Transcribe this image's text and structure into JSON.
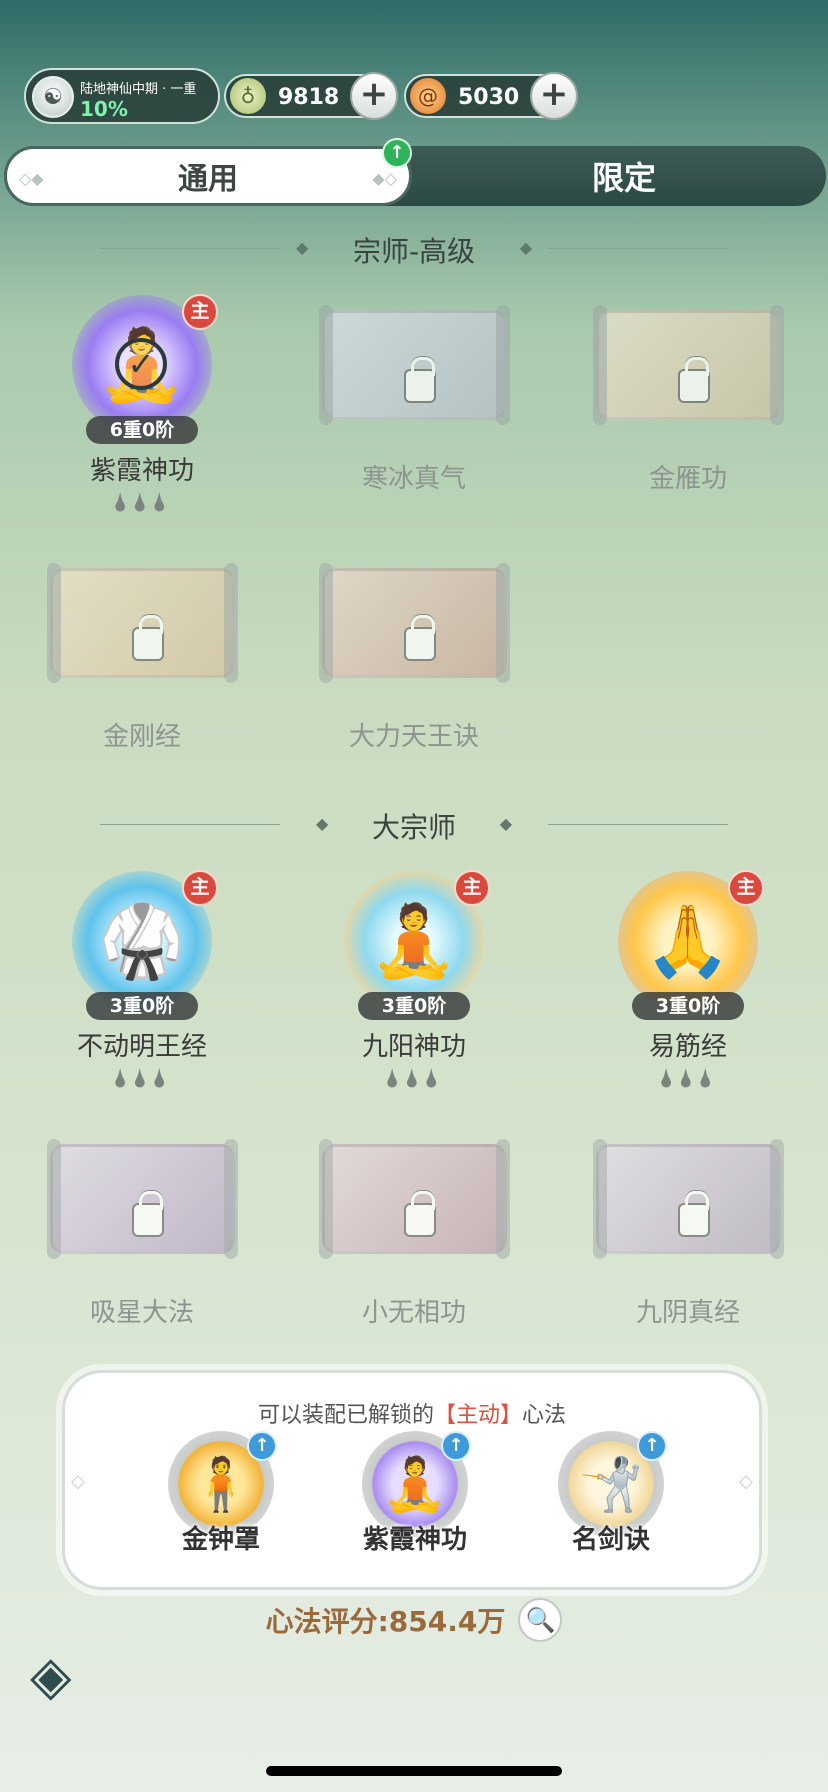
{
  "realm": {
    "name": "陆地神仙中期 · 一重",
    "progress_text": "10%",
    "progress": 0.1,
    "avatar_icon": "cultivator-avatar-icon"
  },
  "currencies": [
    {
      "value": "9818",
      "icon": "jade-gourd-icon",
      "plus": "+"
    },
    {
      "value": "5030",
      "icon": "spiral-coin-icon",
      "plus": "+"
    }
  ],
  "tabs": {
    "active": "通用",
    "inactive": "限定",
    "upgrade_arrow": "↑"
  },
  "sections": [
    {
      "title": "宗师-高级",
      "skills": [
        {
          "name": "紫霞神功",
          "level": "6重0阶",
          "badge": "主",
          "state": "equipped",
          "drops": "🌢🌢🌢"
        },
        {
          "name": "寒冰真气",
          "state": "locked"
        },
        {
          "name": "金雁功",
          "state": "locked"
        },
        {
          "name": "金刚经",
          "state": "locked"
        },
        {
          "name": "大力天王诀",
          "state": "locked"
        }
      ]
    },
    {
      "title": "大宗师",
      "skills": [
        {
          "name": "不动明王经",
          "level": "3重0阶",
          "badge": "主",
          "state": "unlocked",
          "drops": "🌢🌢🌢"
        },
        {
          "name": "九阳神功",
          "level": "3重0阶",
          "badge": "主",
          "state": "unlocked",
          "drops": "🌢🌢🌢"
        },
        {
          "name": "易筋经",
          "level": "3重0阶",
          "badge": "主",
          "state": "unlocked",
          "drops": "🌢🌢🌢"
        },
        {
          "name": "吸星大法",
          "state": "locked"
        },
        {
          "name": "小无相功",
          "state": "locked"
        },
        {
          "name": "九阴真经",
          "state": "locked"
        }
      ]
    }
  ],
  "equip_panel": {
    "hint_pre": "可以装配已解锁的",
    "hint_hl": "【主动】",
    "hint_post": "心法",
    "slots": [
      {
        "name": "金钟罩",
        "icon": "golden-bell-figure-icon"
      },
      {
        "name": "紫霞神功",
        "icon": "purple-meditation-figure-icon"
      },
      {
        "name": "名剑诀",
        "icon": "sword-figure-icon"
      }
    ]
  },
  "score": {
    "label": "心法评分:854.4万"
  },
  "colors": {
    "accent_red": "#d94a3e",
    "accent_green": "#2fb35a",
    "accent_blue": "#3f9ad9",
    "score_brown": "#9b6a3c"
  }
}
